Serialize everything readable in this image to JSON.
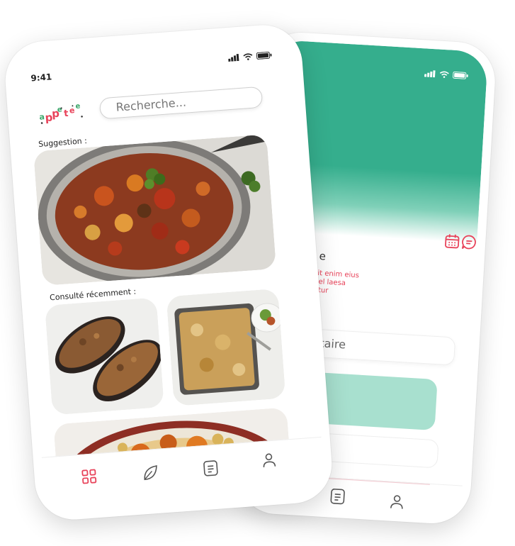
{
  "front_phone": {
    "status_time": "9:41",
    "logo_text": "appetee",
    "search": {
      "placeholder": "Recherche..."
    },
    "suggestion_label": "Suggestion :",
    "recent_label": "Consulté récemment :",
    "images": [
      {
        "name": "ratatouille-pan"
      },
      {
        "name": "stuffed-eggplant"
      },
      {
        "name": "lasagna-dish"
      },
      {
        "name": "couscous-tagine"
      }
    ],
    "nav": [
      {
        "icon": "grid-icon",
        "active": true
      },
      {
        "icon": "leaf-icon",
        "active": false
      },
      {
        "icon": "document-icon",
        "active": false
      },
      {
        "icon": "user-icon",
        "active": false
      }
    ]
  },
  "back_phone": {
    "title_fragment": "e",
    "description_fragment": [
      "rit enim eius",
      "vel laesa",
      "atur"
    ],
    "comment_placeholder_fragment": "taire",
    "nav": [
      {
        "icon": "document-icon"
      },
      {
        "icon": "user-icon"
      }
    ]
  },
  "colors": {
    "accent_pink": "#e8435a",
    "accent_green": "#35ae8d",
    "light_green": "#a8e0cf"
  }
}
